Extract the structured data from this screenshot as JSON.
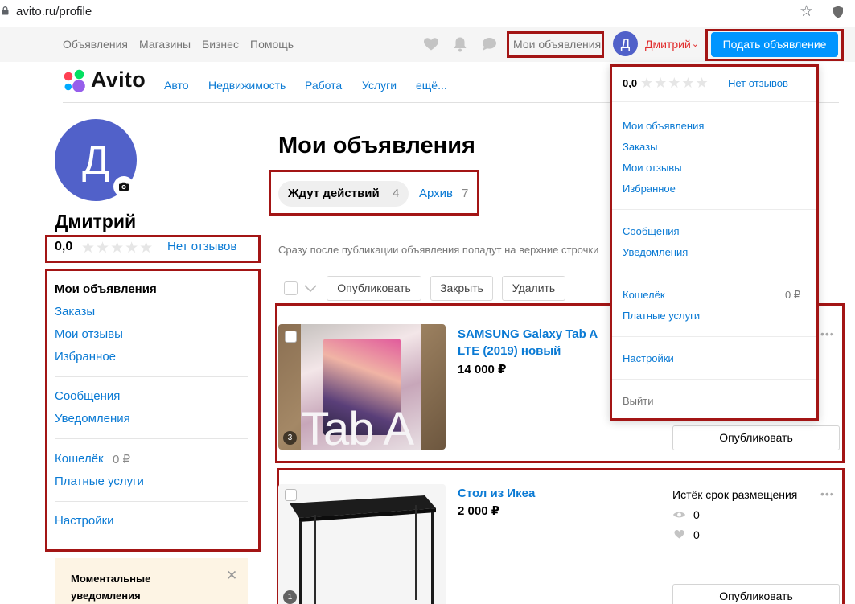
{
  "browser": {
    "url": "avito.ru/profile",
    "lock_icon": "lock-icon",
    "bookmark_icon": "star-icon",
    "extension_icon": "shield-icon"
  },
  "topbar": {
    "links": [
      "Объявления",
      "Магазины",
      "Бизнес",
      "Помощь"
    ],
    "favorites_icon": "heart-icon",
    "notifications_icon": "bell-icon",
    "messages_icon": "chat-icon",
    "my_ads": "Мои объявления",
    "avatar_letter": "Д",
    "username": "Дмитрий",
    "username_chevron": "⌄",
    "post_ad": "Подать объявление"
  },
  "nav": {
    "logo": "Avito",
    "categories": [
      "Авто",
      "Недвижимость",
      "Работа",
      "Услуги",
      "ещё..."
    ]
  },
  "profile": {
    "avatar_letter": "Д",
    "camera_icon": "camera-icon",
    "name": "Дмитрий",
    "rating": "0,0",
    "stars": "★★★★★",
    "no_reviews": "Нет отзывов",
    "menu": {
      "my_ads": "Мои объявления",
      "orders": "Заказы",
      "my_reviews": "Мои отзывы",
      "favorites": "Избранное",
      "messages": "Сообщения",
      "notifications": "Уведомления",
      "wallet": "Кошелёк",
      "wallet_amount": "0 ₽",
      "paid_services": "Платные услуги",
      "settings": "Настройки"
    },
    "notify_banner": {
      "title": "Моментальные уведомления",
      "close": "✕"
    }
  },
  "main": {
    "title": "Мои объявления",
    "tabs": [
      {
        "label": "Ждут действий",
        "count": "4"
      },
      {
        "label": "Архив",
        "count": "7"
      }
    ],
    "info": "Сразу после публикации объявления попадут на верхние строчки",
    "actions": [
      "Опубликовать",
      "Закрыть",
      "Удалить"
    ]
  },
  "listings": [
    {
      "title_line1": "SAMSUNG Galaxy Tab A",
      "title_line2": "LTE (2019) новый",
      "price": "14 000 ₽",
      "photo_count": "3",
      "publish": "Опубликовать",
      "more": "•••",
      "thumb_text": "Tab A"
    },
    {
      "title": "Стол из Икеа",
      "price": "2 000 ₽",
      "status": "Истёк срок размещения",
      "views": "0",
      "favorites": "0",
      "photo_count": "1",
      "publish": "Опубликовать",
      "more": "•••"
    }
  ],
  "dropdown": {
    "rating": "0,0",
    "stars": "★★★★★",
    "no_reviews": "Нет отзывов",
    "my_ads": "Мои объявления",
    "orders": "Заказы",
    "my_reviews": "Мои отзывы",
    "favorites": "Избранное",
    "messages": "Сообщения",
    "notifications": "Уведомления",
    "wallet": "Кошелёк",
    "wallet_amount": "0 ₽",
    "paid_services": "Платные услуги",
    "settings": "Настройки",
    "logout": "Выйти"
  },
  "colors": {
    "link_blue": "#0a7ad4",
    "primary_button": "#0095ff",
    "avatar_purple": "#5161c9",
    "username_red": "#e12c2c",
    "annotation_red": "#a31515"
  }
}
